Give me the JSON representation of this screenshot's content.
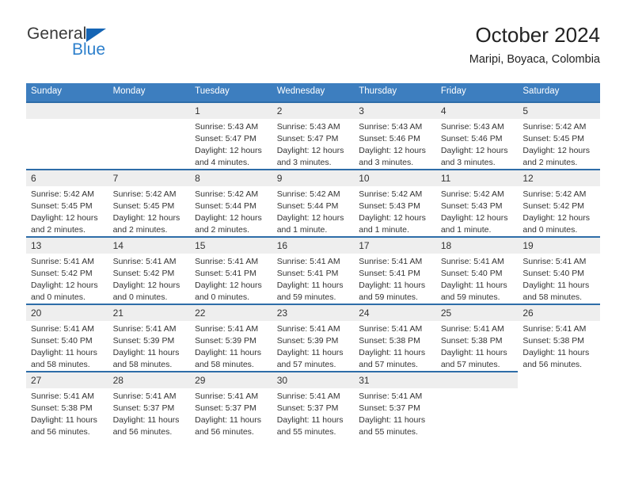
{
  "brand": {
    "name_top": "General",
    "name_bottom": "Blue",
    "accent_color": "#2e80cc",
    "triangle_color": "#1565b5"
  },
  "header": {
    "title": "October 2024",
    "subtitle": "Maripi, Boyaca, Colombia"
  },
  "theme": {
    "header_row_bg": "#3d7ebf",
    "row_divider": "#2e6da8",
    "daynum_bg": "#eeeeee",
    "text": "#333333"
  },
  "weekdays": [
    "Sunday",
    "Monday",
    "Tuesday",
    "Wednesday",
    "Thursday",
    "Friday",
    "Saturday"
  ],
  "weeks": [
    [
      {
        "day": "",
        "blank": true
      },
      {
        "day": "",
        "blank": true
      },
      {
        "day": "1",
        "sunrise": "Sunrise: 5:43 AM",
        "sunset": "Sunset: 5:47 PM",
        "daylight1": "Daylight: 12 hours",
        "daylight2": "and 4 minutes."
      },
      {
        "day": "2",
        "sunrise": "Sunrise: 5:43 AM",
        "sunset": "Sunset: 5:47 PM",
        "daylight1": "Daylight: 12 hours",
        "daylight2": "and 3 minutes."
      },
      {
        "day": "3",
        "sunrise": "Sunrise: 5:43 AM",
        "sunset": "Sunset: 5:46 PM",
        "daylight1": "Daylight: 12 hours",
        "daylight2": "and 3 minutes."
      },
      {
        "day": "4",
        "sunrise": "Sunrise: 5:43 AM",
        "sunset": "Sunset: 5:46 PM",
        "daylight1": "Daylight: 12 hours",
        "daylight2": "and 3 minutes."
      },
      {
        "day": "5",
        "sunrise": "Sunrise: 5:42 AM",
        "sunset": "Sunset: 5:45 PM",
        "daylight1": "Daylight: 12 hours",
        "daylight2": "and 2 minutes."
      }
    ],
    [
      {
        "day": "6",
        "sunrise": "Sunrise: 5:42 AM",
        "sunset": "Sunset: 5:45 PM",
        "daylight1": "Daylight: 12 hours",
        "daylight2": "and 2 minutes."
      },
      {
        "day": "7",
        "sunrise": "Sunrise: 5:42 AM",
        "sunset": "Sunset: 5:45 PM",
        "daylight1": "Daylight: 12 hours",
        "daylight2": "and 2 minutes."
      },
      {
        "day": "8",
        "sunrise": "Sunrise: 5:42 AM",
        "sunset": "Sunset: 5:44 PM",
        "daylight1": "Daylight: 12 hours",
        "daylight2": "and 2 minutes."
      },
      {
        "day": "9",
        "sunrise": "Sunrise: 5:42 AM",
        "sunset": "Sunset: 5:44 PM",
        "daylight1": "Daylight: 12 hours",
        "daylight2": "and 1 minute."
      },
      {
        "day": "10",
        "sunrise": "Sunrise: 5:42 AM",
        "sunset": "Sunset: 5:43 PM",
        "daylight1": "Daylight: 12 hours",
        "daylight2": "and 1 minute."
      },
      {
        "day": "11",
        "sunrise": "Sunrise: 5:42 AM",
        "sunset": "Sunset: 5:43 PM",
        "daylight1": "Daylight: 12 hours",
        "daylight2": "and 1 minute."
      },
      {
        "day": "12",
        "sunrise": "Sunrise: 5:42 AM",
        "sunset": "Sunset: 5:42 PM",
        "daylight1": "Daylight: 12 hours",
        "daylight2": "and 0 minutes."
      }
    ],
    [
      {
        "day": "13",
        "sunrise": "Sunrise: 5:41 AM",
        "sunset": "Sunset: 5:42 PM",
        "daylight1": "Daylight: 12 hours",
        "daylight2": "and 0 minutes."
      },
      {
        "day": "14",
        "sunrise": "Sunrise: 5:41 AM",
        "sunset": "Sunset: 5:42 PM",
        "daylight1": "Daylight: 12 hours",
        "daylight2": "and 0 minutes."
      },
      {
        "day": "15",
        "sunrise": "Sunrise: 5:41 AM",
        "sunset": "Sunset: 5:41 PM",
        "daylight1": "Daylight: 12 hours",
        "daylight2": "and 0 minutes."
      },
      {
        "day": "16",
        "sunrise": "Sunrise: 5:41 AM",
        "sunset": "Sunset: 5:41 PM",
        "daylight1": "Daylight: 11 hours",
        "daylight2": "and 59 minutes."
      },
      {
        "day": "17",
        "sunrise": "Sunrise: 5:41 AM",
        "sunset": "Sunset: 5:41 PM",
        "daylight1": "Daylight: 11 hours",
        "daylight2": "and 59 minutes."
      },
      {
        "day": "18",
        "sunrise": "Sunrise: 5:41 AM",
        "sunset": "Sunset: 5:40 PM",
        "daylight1": "Daylight: 11 hours",
        "daylight2": "and 59 minutes."
      },
      {
        "day": "19",
        "sunrise": "Sunrise: 5:41 AM",
        "sunset": "Sunset: 5:40 PM",
        "daylight1": "Daylight: 11 hours",
        "daylight2": "and 58 minutes."
      }
    ],
    [
      {
        "day": "20",
        "sunrise": "Sunrise: 5:41 AM",
        "sunset": "Sunset: 5:40 PM",
        "daylight1": "Daylight: 11 hours",
        "daylight2": "and 58 minutes."
      },
      {
        "day": "21",
        "sunrise": "Sunrise: 5:41 AM",
        "sunset": "Sunset: 5:39 PM",
        "daylight1": "Daylight: 11 hours",
        "daylight2": "and 58 minutes."
      },
      {
        "day": "22",
        "sunrise": "Sunrise: 5:41 AM",
        "sunset": "Sunset: 5:39 PM",
        "daylight1": "Daylight: 11 hours",
        "daylight2": "and 58 minutes."
      },
      {
        "day": "23",
        "sunrise": "Sunrise: 5:41 AM",
        "sunset": "Sunset: 5:39 PM",
        "daylight1": "Daylight: 11 hours",
        "daylight2": "and 57 minutes."
      },
      {
        "day": "24",
        "sunrise": "Sunrise: 5:41 AM",
        "sunset": "Sunset: 5:38 PM",
        "daylight1": "Daylight: 11 hours",
        "daylight2": "and 57 minutes."
      },
      {
        "day": "25",
        "sunrise": "Sunrise: 5:41 AM",
        "sunset": "Sunset: 5:38 PM",
        "daylight1": "Daylight: 11 hours",
        "daylight2": "and 57 minutes."
      },
      {
        "day": "26",
        "sunrise": "Sunrise: 5:41 AM",
        "sunset": "Sunset: 5:38 PM",
        "daylight1": "Daylight: 11 hours",
        "daylight2": "and 56 minutes."
      }
    ],
    [
      {
        "day": "27",
        "sunrise": "Sunrise: 5:41 AM",
        "sunset": "Sunset: 5:38 PM",
        "daylight1": "Daylight: 11 hours",
        "daylight2": "and 56 minutes."
      },
      {
        "day": "28",
        "sunrise": "Sunrise: 5:41 AM",
        "sunset": "Sunset: 5:37 PM",
        "daylight1": "Daylight: 11 hours",
        "daylight2": "and 56 minutes."
      },
      {
        "day": "29",
        "sunrise": "Sunrise: 5:41 AM",
        "sunset": "Sunset: 5:37 PM",
        "daylight1": "Daylight: 11 hours",
        "daylight2": "and 56 minutes."
      },
      {
        "day": "30",
        "sunrise": "Sunrise: 5:41 AM",
        "sunset": "Sunset: 5:37 PM",
        "daylight1": "Daylight: 11 hours",
        "daylight2": "and 55 minutes."
      },
      {
        "day": "31",
        "sunrise": "Sunrise: 5:41 AM",
        "sunset": "Sunset: 5:37 PM",
        "daylight1": "Daylight: 11 hours",
        "daylight2": "and 55 minutes."
      },
      {
        "day": "",
        "blank": true
      },
      {
        "day": "",
        "blank": true,
        "hidden": true
      }
    ]
  ]
}
